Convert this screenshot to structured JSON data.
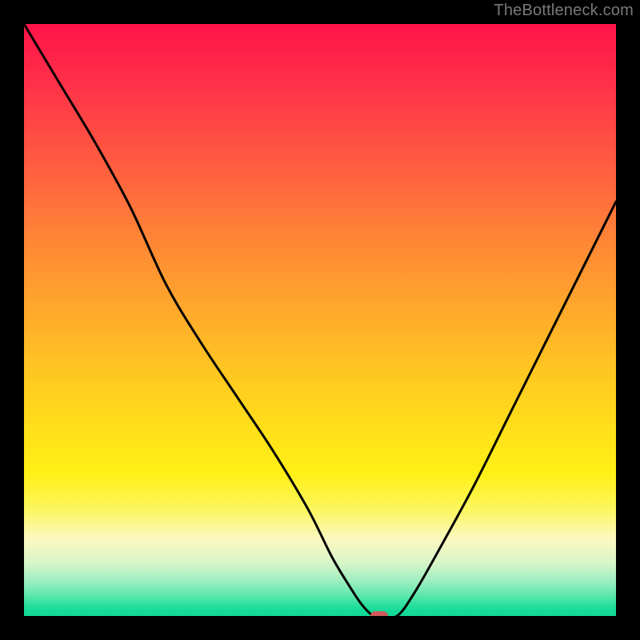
{
  "watermark": "TheBottleneck.com",
  "chart_data": {
    "type": "line",
    "title": "",
    "xlabel": "",
    "ylabel": "",
    "xlim": [
      0,
      100
    ],
    "ylim": [
      0,
      100
    ],
    "grid": false,
    "legend": false,
    "series": [
      {
        "name": "bottleneck-curve",
        "x": [
          0,
          6,
          12,
          18,
          24,
          30,
          36,
          42,
          48,
          52,
          55,
          57,
          59,
          60,
          63,
          66,
          70,
          76,
          82,
          88,
          94,
          100
        ],
        "y": [
          100,
          90,
          80,
          69,
          56,
          46,
          37,
          28,
          18,
          10,
          5,
          2,
          0,
          0,
          0,
          4,
          11,
          22,
          34,
          46,
          58,
          70
        ]
      }
    ],
    "optimal_marker": {
      "x": 60,
      "y": 0
    },
    "background_gradient": {
      "top": "#ff1449",
      "mid": "#ffde1a",
      "bottom": "#11d996"
    }
  },
  "colors": {
    "frame": "#000000",
    "curve": "#000000",
    "marker": "#cf5a5b",
    "watermark": "#7a7a7a"
  }
}
